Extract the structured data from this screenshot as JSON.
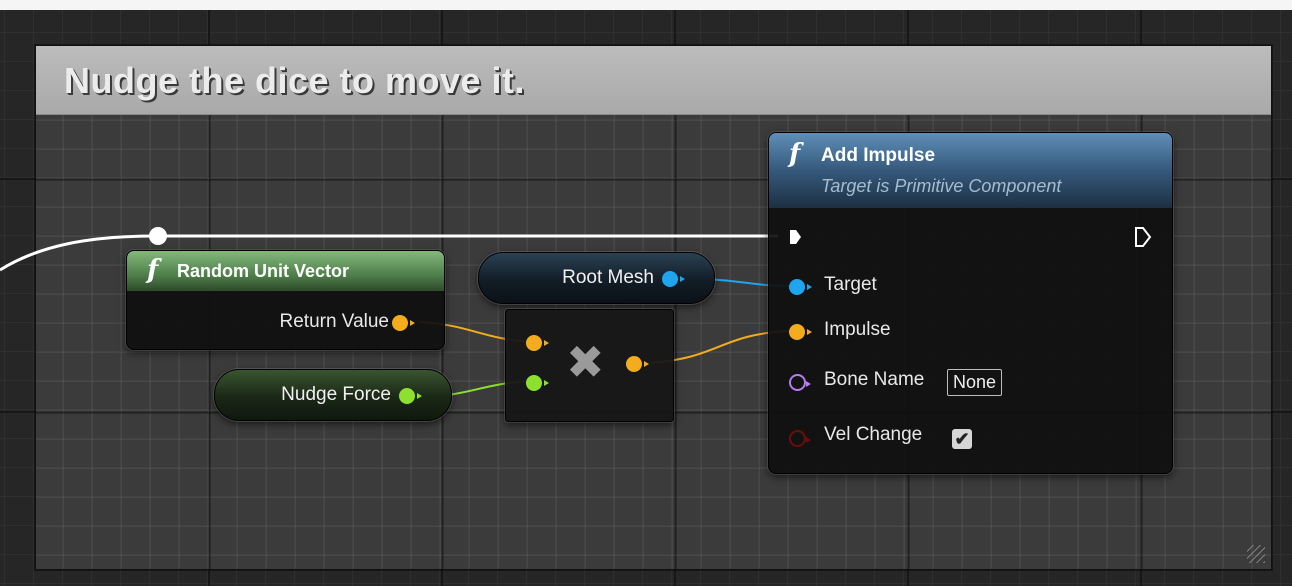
{
  "comment": {
    "title": "Nudge the dice to move it."
  },
  "nodes": {
    "random_unit_vector": {
      "fn_glyph": "f",
      "title": "Random Unit Vector",
      "output_label": "Return Value"
    },
    "root_mesh": {
      "label": "Root Mesh"
    },
    "nudge_force": {
      "label": "Nudge Force"
    },
    "multiply": {
      "operator": "✖"
    },
    "add_impulse": {
      "fn_glyph": "f",
      "title": "Add Impulse",
      "subtitle": "Target is Primitive Component",
      "pins": {
        "target": "Target",
        "impulse": "Impulse",
        "bone_name": "Bone Name",
        "vel_change": "Vel Change"
      },
      "bone_name_value": "None",
      "vel_change_checked": true,
      "checkbox_glyph": "✔"
    }
  },
  "colors": {
    "exec_wire": "#ffffff",
    "vector_pin": "#f2ac1e",
    "float_pin": "#8ee02e",
    "object_pin": "#1ea5ee",
    "name_pin": "#b57cef",
    "bool_pin": "#6b0d0d",
    "pure_fn_header": "#6fa56a",
    "fn_header": "#3f6f9b"
  }
}
